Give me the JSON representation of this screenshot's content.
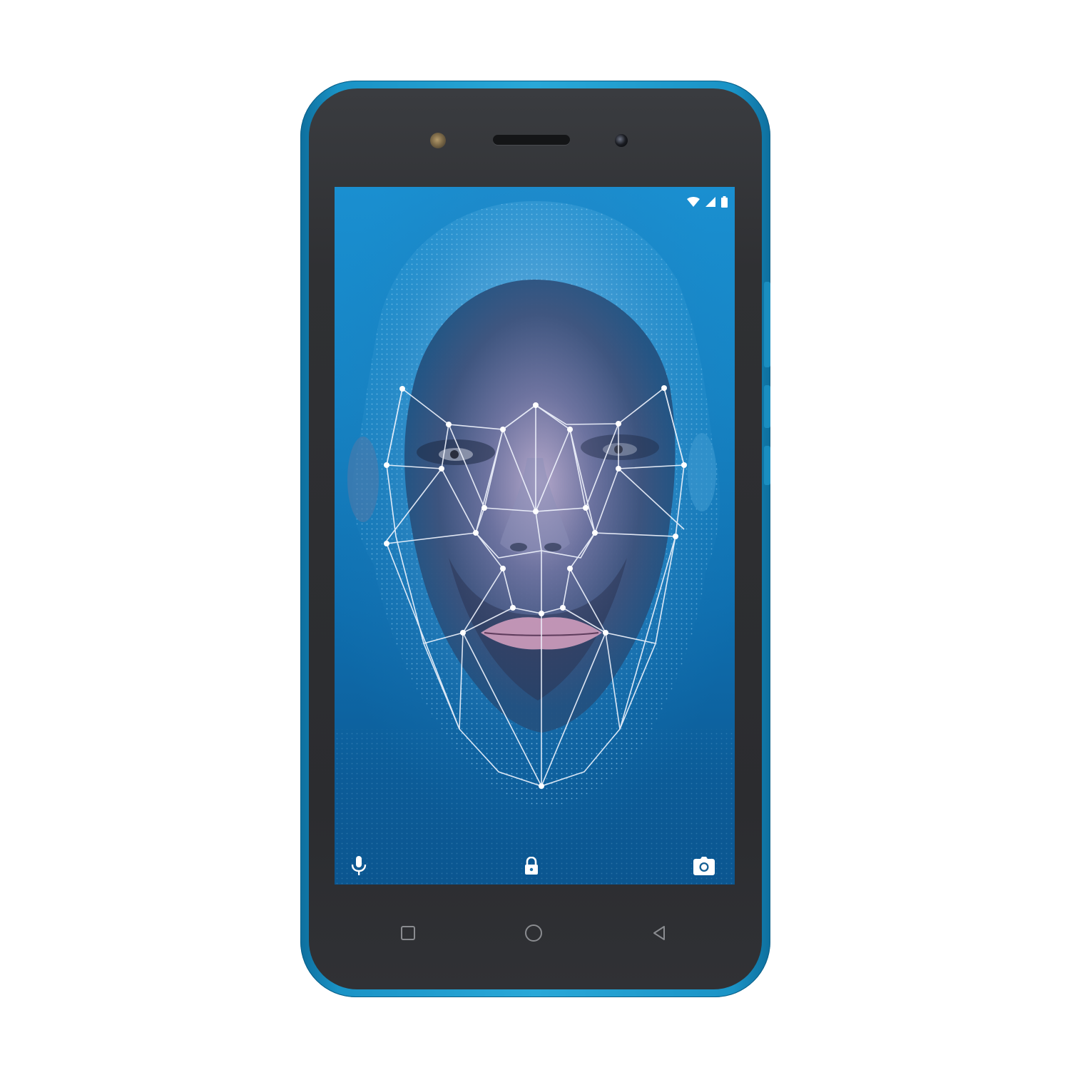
{
  "device": {
    "frame_color": "#1a93c6",
    "front_color": "#2f3033"
  },
  "status_bar": {
    "icons": [
      "wifi-icon",
      "cellular-signal-icon",
      "battery-icon"
    ]
  },
  "lock_screen": {
    "shortcuts": [
      "microphone-icon",
      "lock-icon",
      "camera-icon"
    ],
    "wallpaper": "face-recognition-wireframe"
  },
  "navigation_keys": [
    "recent-apps-icon",
    "home-icon",
    "back-icon"
  ]
}
